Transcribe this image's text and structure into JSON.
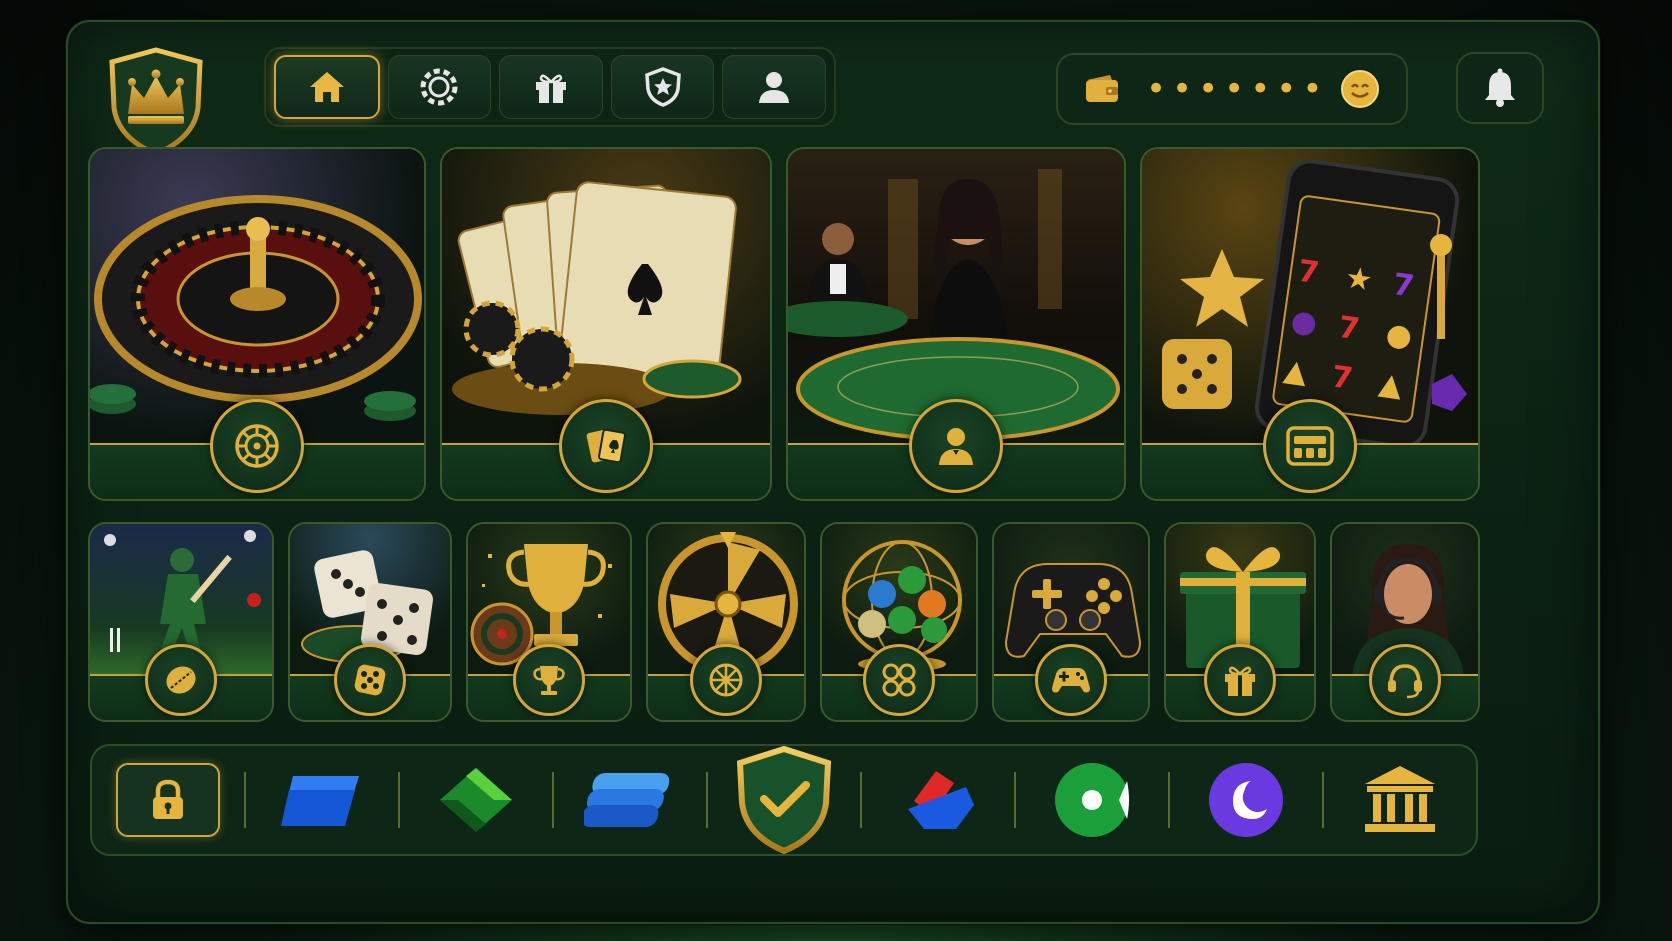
{
  "header": {
    "logo": "crown-shield-logo",
    "tabs": [
      {
        "name": "home",
        "icon": "home-icon",
        "active": true
      },
      {
        "name": "casino",
        "icon": "chip-icon",
        "active": false
      },
      {
        "name": "gifts",
        "icon": "gift-icon",
        "active": false
      },
      {
        "name": "vip",
        "icon": "star-shield-icon",
        "active": false
      },
      {
        "name": "profile",
        "icon": "user-icon",
        "active": false
      }
    ],
    "wallet": {
      "balance_masked": "•••••••",
      "icon": "wallet-icon",
      "face_icon": "smile-coin-icon"
    },
    "notifications_icon": "bell-icon"
  },
  "featured": [
    {
      "name": "roulette",
      "icon": "roulette-wheel-icon"
    },
    {
      "name": "cards",
      "icon": "cards-icon"
    },
    {
      "name": "live-dealer",
      "icon": "dealer-icon"
    },
    {
      "name": "slots",
      "icon": "slot-machine-icon"
    }
  ],
  "categories": [
    {
      "name": "cricket",
      "icon": "cricket-ball-icon"
    },
    {
      "name": "dice",
      "icon": "dice-icon"
    },
    {
      "name": "tournaments",
      "icon": "trophy-icon"
    },
    {
      "name": "wheel",
      "icon": "wheel-icon"
    },
    {
      "name": "lottery",
      "icon": "lottery-balls-icon"
    },
    {
      "name": "games",
      "icon": "gamepad-icon"
    },
    {
      "name": "promotions",
      "icon": "gift-icon"
    },
    {
      "name": "support",
      "icon": "headset-icon"
    }
  ],
  "payments": [
    {
      "name": "secure-lock",
      "icon": "lock-icon"
    },
    {
      "name": "blue-wallet",
      "icon": "blue-tilted-card-icon"
    },
    {
      "name": "green-wallet",
      "icon": "green-diamond-icon"
    },
    {
      "name": "blue-cards",
      "icon": "blue-stacked-cards-icon"
    },
    {
      "name": "verified",
      "icon": "shield-check-icon"
    },
    {
      "name": "red-blue-wallet",
      "icon": "red-blue-wallet-icon"
    },
    {
      "name": "green-circle",
      "icon": "green-circle-icon"
    },
    {
      "name": "purple-moon",
      "icon": "purple-moon-icon"
    },
    {
      "name": "bank",
      "icon": "bank-icon"
    }
  ],
  "colors": {
    "accent_gold": "#e2b13c",
    "panel_green": "#0f2a17",
    "border_green": "#3b5a2c"
  }
}
